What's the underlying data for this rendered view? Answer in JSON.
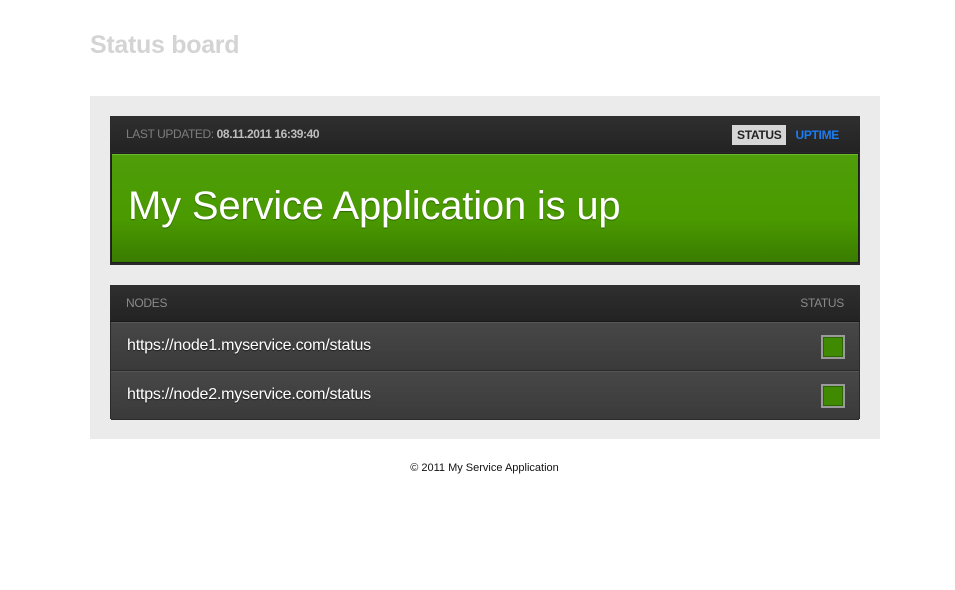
{
  "page": {
    "title": "Status board"
  },
  "status_panel": {
    "last_updated_label": "LAST UPDATED:",
    "last_updated_value": "08.11.2011 16:39:40",
    "tabs": [
      {
        "label": "STATUS",
        "active": true
      },
      {
        "label": "UPTIME",
        "active": false
      }
    ],
    "banner_text": "My Service Application is up",
    "banner_color": "#4a9a00"
  },
  "nodes_panel": {
    "header_label": "NODES",
    "header_status": "STATUS",
    "nodes": [
      {
        "url": "https://node1.myservice.com/status",
        "status": "up",
        "status_color": "#3f8a00"
      },
      {
        "url": "https://node2.myservice.com/status",
        "status": "up",
        "status_color": "#3f8a00"
      }
    ]
  },
  "footer": {
    "text": "© 2011 My Service Application"
  },
  "colors": {
    "accent_link": "#1a7cf0",
    "panel_bg": "#2a2a2a",
    "board_bg": "#ebebeb"
  }
}
